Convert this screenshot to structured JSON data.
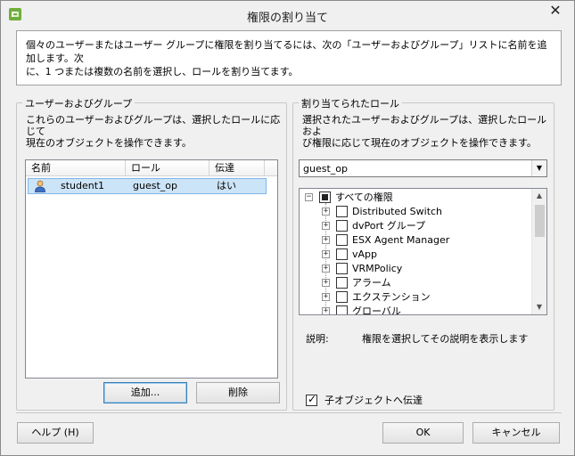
{
  "window": {
    "title": "権限の割り当て",
    "close_glyph": "✕"
  },
  "intro": {
    "line1": "個々のユーザーまたはユーザー グループに権限を割り当てるには、次の「ユーザーおよびグループ」リストに名前を追加します。次",
    "line2": "に、1 つまたは複数の名前を選択し、ロールを割り当てます。"
  },
  "users_group": {
    "legend": "ユーザーおよびグループ",
    "desc_line1": "これらのユーザーおよびグループは、選択したロールに応じて",
    "desc_line2": "現在のオブジェクトを操作できます。",
    "columns": [
      "名前",
      "ロール",
      "伝達"
    ],
    "rows": [
      {
        "name": "student1",
        "role": "guest_op",
        "propagate": "はい",
        "icon": "user-icon"
      }
    ],
    "add_label": "追加...",
    "remove_label": "削除"
  },
  "roles_group": {
    "legend": "割り当てられたロール",
    "desc_line1": "選択されたユーザーおよびグループは、選択したロールおよ",
    "desc_line2": "び権限に応じて現在のオブジェクトを操作できます。",
    "selected_role": "guest_op",
    "tree_root": "すべての権限",
    "tree_items": [
      "Distributed Switch",
      "dvPort グループ",
      "ESX Agent Manager",
      "vApp",
      "VRMPolicy",
      "アラーム",
      "エクステンション",
      "グローバル"
    ],
    "description_label": "説明:",
    "description_value": "権限を選択してその説明を表示します",
    "propagate_label": "子オブジェクトへ伝達"
  },
  "footer": {
    "help_label": "ヘルプ (H)",
    "ok_label": "OK",
    "cancel_label": "キャンセル"
  }
}
